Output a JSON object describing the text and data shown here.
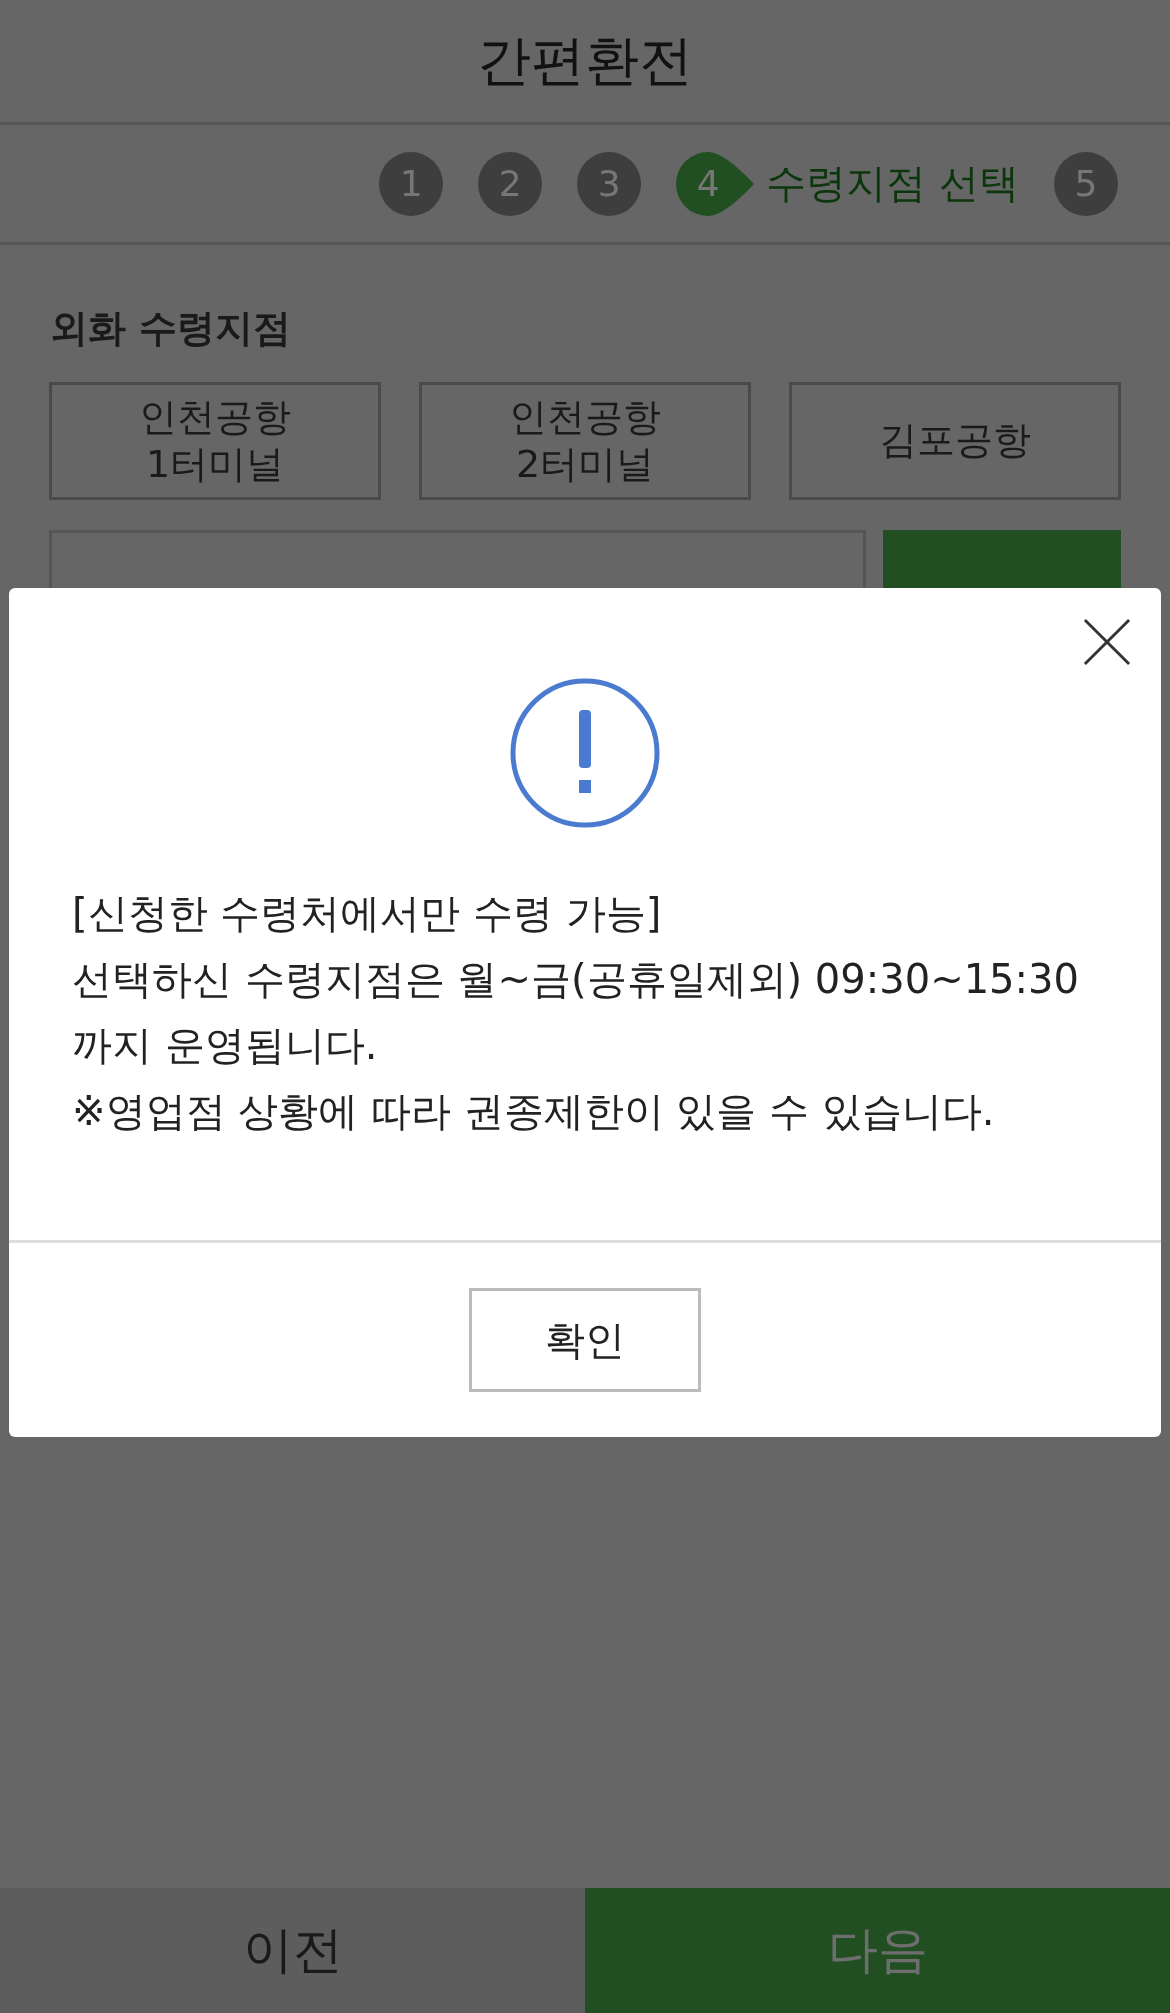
{
  "header": {
    "title": "간편환전"
  },
  "steps": [
    {
      "number": "1",
      "selected": false
    },
    {
      "number": "2",
      "selected": false
    },
    {
      "number": "3",
      "selected": false
    },
    {
      "number": "4",
      "selected": true,
      "label": "수령지점 선택"
    },
    {
      "number": "5",
      "selected": false
    }
  ],
  "section": {
    "title": "외화 수령지점",
    "locations": [
      {
        "lines": [
          "인천공항",
          "1터미널"
        ]
      },
      {
        "lines": [
          "인천공항",
          "2터미널"
        ]
      },
      {
        "lines": [
          "김포공항"
        ]
      }
    ]
  },
  "dialog": {
    "heading": "[신청한 수령처에서만 수령 가능]",
    "message": "선택하신 수령지점은 월~금(공휴일제외) 09:30~15:30까지 운영됩니다.",
    "note": "※영업점 상황에 따라 권종제한이 있을 수 있습니다.",
    "confirm": "확인"
  },
  "footer": {
    "prev": "이전",
    "next": "다음"
  }
}
